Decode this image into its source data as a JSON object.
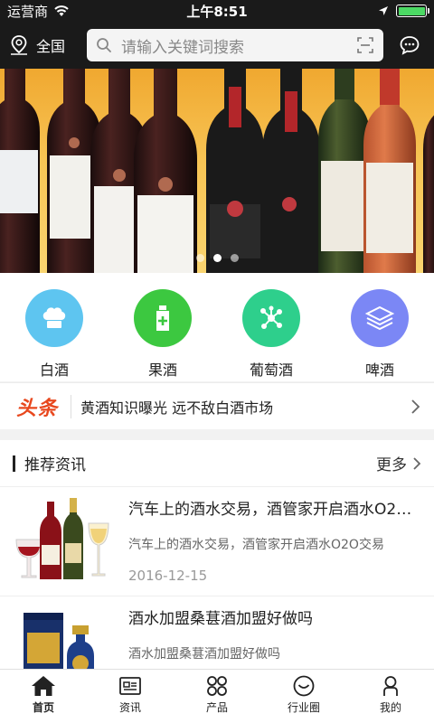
{
  "status_bar": {
    "carrier": "运营商",
    "time": "上午8:51",
    "battery_level": 1.0
  },
  "header": {
    "location_label": "全国",
    "search_placeholder": "请输入关键词搜索",
    "icons": [
      "location-pin-icon",
      "search-icon",
      "scan-icon",
      "chat-bubble-icon"
    ]
  },
  "banner": {
    "slide_count": 3,
    "active_index": 1
  },
  "categories": [
    {
      "label": "白酒",
      "icon": "chef-hat-icon",
      "color": "#5ec5f0"
    },
    {
      "label": "果酒",
      "icon": "bottle-plus-icon",
      "color": "#3cc840"
    },
    {
      "label": "葡萄酒",
      "icon": "molecule-icon",
      "color": "#2ecf8c"
    },
    {
      "label": "啤酒",
      "icon": "layers-icon",
      "color": "#7b87f5"
    }
  ],
  "headline": {
    "badge": "头条",
    "text": "黄酒知识曝光 远不敌白酒市场"
  },
  "news_section": {
    "title": "推荐资讯",
    "more": "更多",
    "items": [
      {
        "title": "汽车上的酒水交易，酒管家开启酒水O2O交易",
        "desc": "汽车上的酒水交易，酒管家开启酒水O2O交易",
        "date": "2016-12-15"
      },
      {
        "title": "酒水加盟桑葚酒加盟好做吗",
        "desc": "酒水加盟桑葚酒加盟好做吗",
        "date": ""
      }
    ]
  },
  "tabbar": {
    "active": 0,
    "tabs": [
      {
        "label": "首页",
        "icon": "home-icon"
      },
      {
        "label": "资讯",
        "icon": "news-icon"
      },
      {
        "label": "产品",
        "icon": "grid-icon"
      },
      {
        "label": "行业圈",
        "icon": "smile-circle-icon"
      },
      {
        "label": "我的",
        "icon": "person-icon"
      }
    ]
  },
  "colors": {
    "header_bg": "#1a1a1a",
    "headline_accent": "#e8481e",
    "battery_green": "#4cd964"
  }
}
